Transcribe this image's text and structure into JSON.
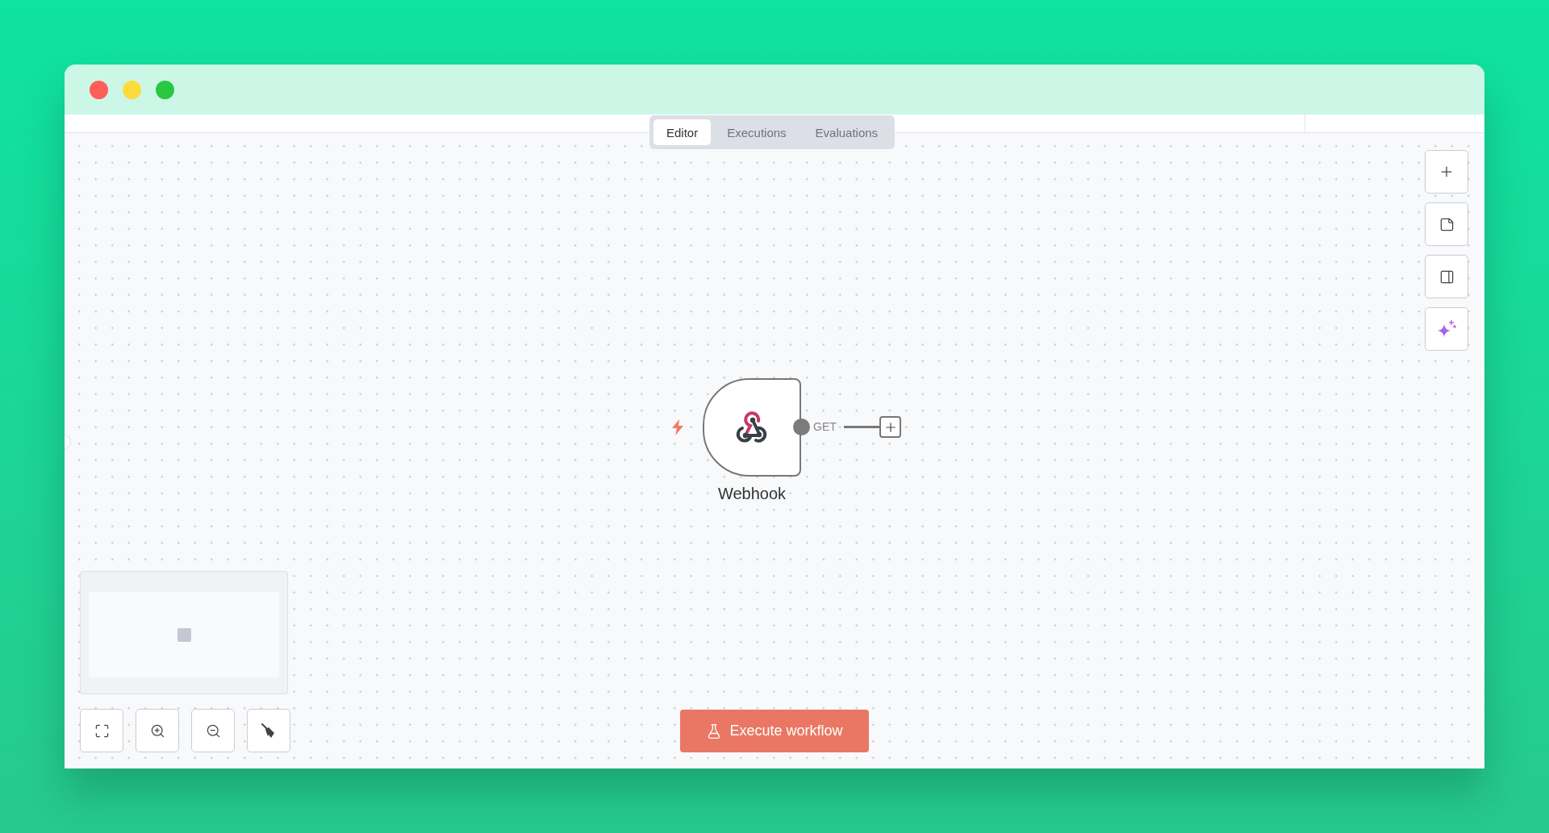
{
  "window_controls": [
    {
      "color": "#ff5f57"
    },
    {
      "color": "#fedb3d"
    },
    {
      "color": "#28c840"
    }
  ],
  "tabs": [
    {
      "label": "Editor",
      "selected": true
    },
    {
      "label": "Executions",
      "selected": false
    },
    {
      "label": "Evaluations",
      "selected": false
    }
  ],
  "node": {
    "name": "Webhook",
    "output_label": "GET"
  },
  "execute_button": {
    "label": "Execute workflow"
  }
}
